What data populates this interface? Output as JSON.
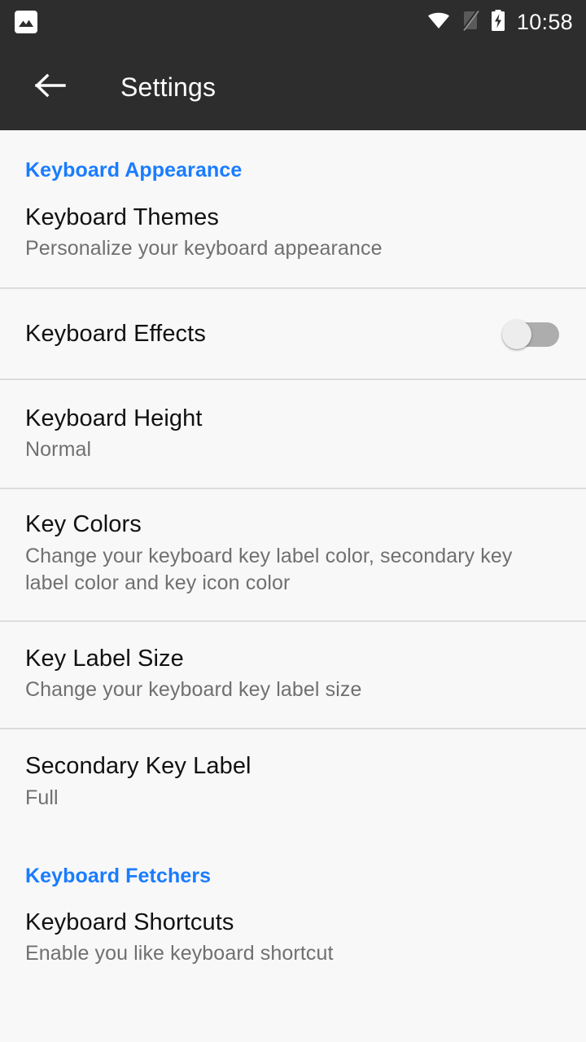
{
  "status_bar": {
    "notification_icon": "image-photo-icon",
    "icons": [
      "wifi-icon",
      "no-sim-signal-icon",
      "battery-charging-icon"
    ],
    "clock": "10:58"
  },
  "toolbar": {
    "back_icon": "arrow-back-icon",
    "title": "Settings"
  },
  "colors": {
    "accent_blue": "#1a7cff",
    "toolbar_bg": "#2d2d2d",
    "page_bg": "#f8f8f8",
    "title_text": "#111111",
    "summary_text": "#707070",
    "divider": "#dcdcdc",
    "switch_track_off": "#adadad",
    "switch_knob_off": "#ededed"
  },
  "sections": [
    {
      "header": "Keyboard Appearance",
      "items": [
        {
          "title": "Keyboard Themes",
          "summary": "Personalize your keyboard appearance"
        },
        {
          "title": "Keyboard Effects",
          "summary": "",
          "switch_state": "off"
        },
        {
          "title": "Keyboard Height",
          "summary": "Normal"
        },
        {
          "title": "Key Colors",
          "summary": "Change your keyboard key label color, secondary key label color and key icon color"
        },
        {
          "title": "Key Label Size",
          "summary": "Change your keyboard key label size"
        },
        {
          "title": "Secondary Key Label",
          "summary": "Full"
        }
      ]
    },
    {
      "header": "Keyboard Fetchers",
      "items": [
        {
          "title": "Keyboard Shortcuts",
          "summary": "Enable you like keyboard  shortcut"
        }
      ]
    }
  ]
}
